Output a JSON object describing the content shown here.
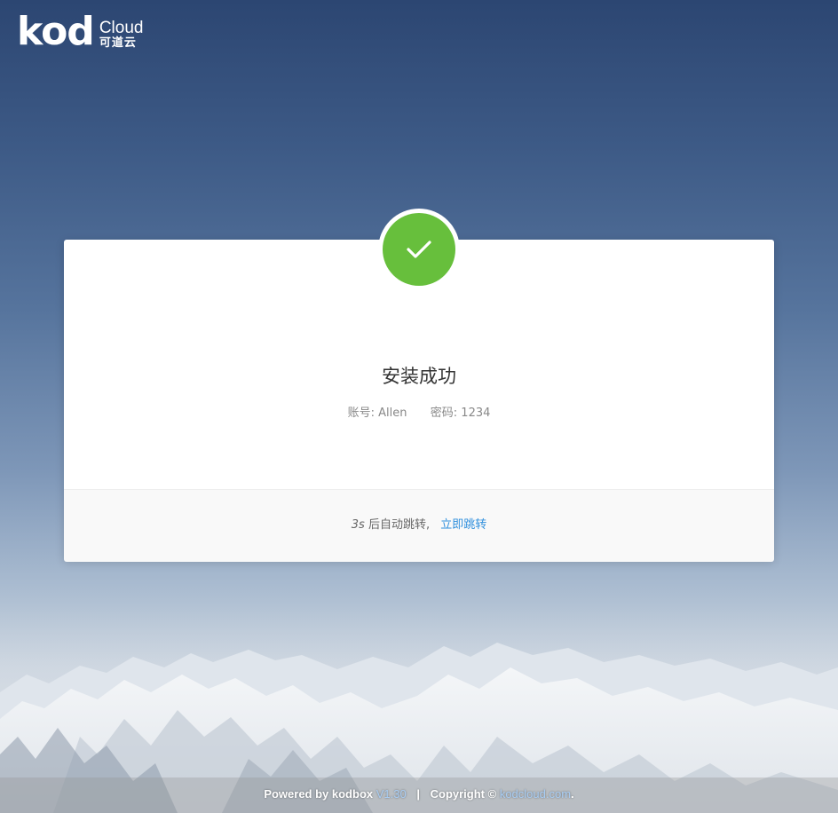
{
  "logo": {
    "mark": "kod",
    "cloud": "Cloud",
    "cn": "可道云"
  },
  "card": {
    "title": "安装成功",
    "account_label": "账号:",
    "account_value": "Allen",
    "password_label": "密码:",
    "password_value": "1234",
    "countdown": "3s",
    "redirect_text": "后自动跳转,",
    "jump_link": "立即跳转",
    "success_icon": "check-icon"
  },
  "footer": {
    "powered": "Powered by kodbox",
    "version": "V1.30",
    "sep": "|",
    "copyright": "Copyright ©",
    "site": "kodcloud.com",
    "dot": "."
  },
  "colors": {
    "success": "#67bf3c",
    "link": "#2f8fdd",
    "bg_top": "#2c4672"
  }
}
